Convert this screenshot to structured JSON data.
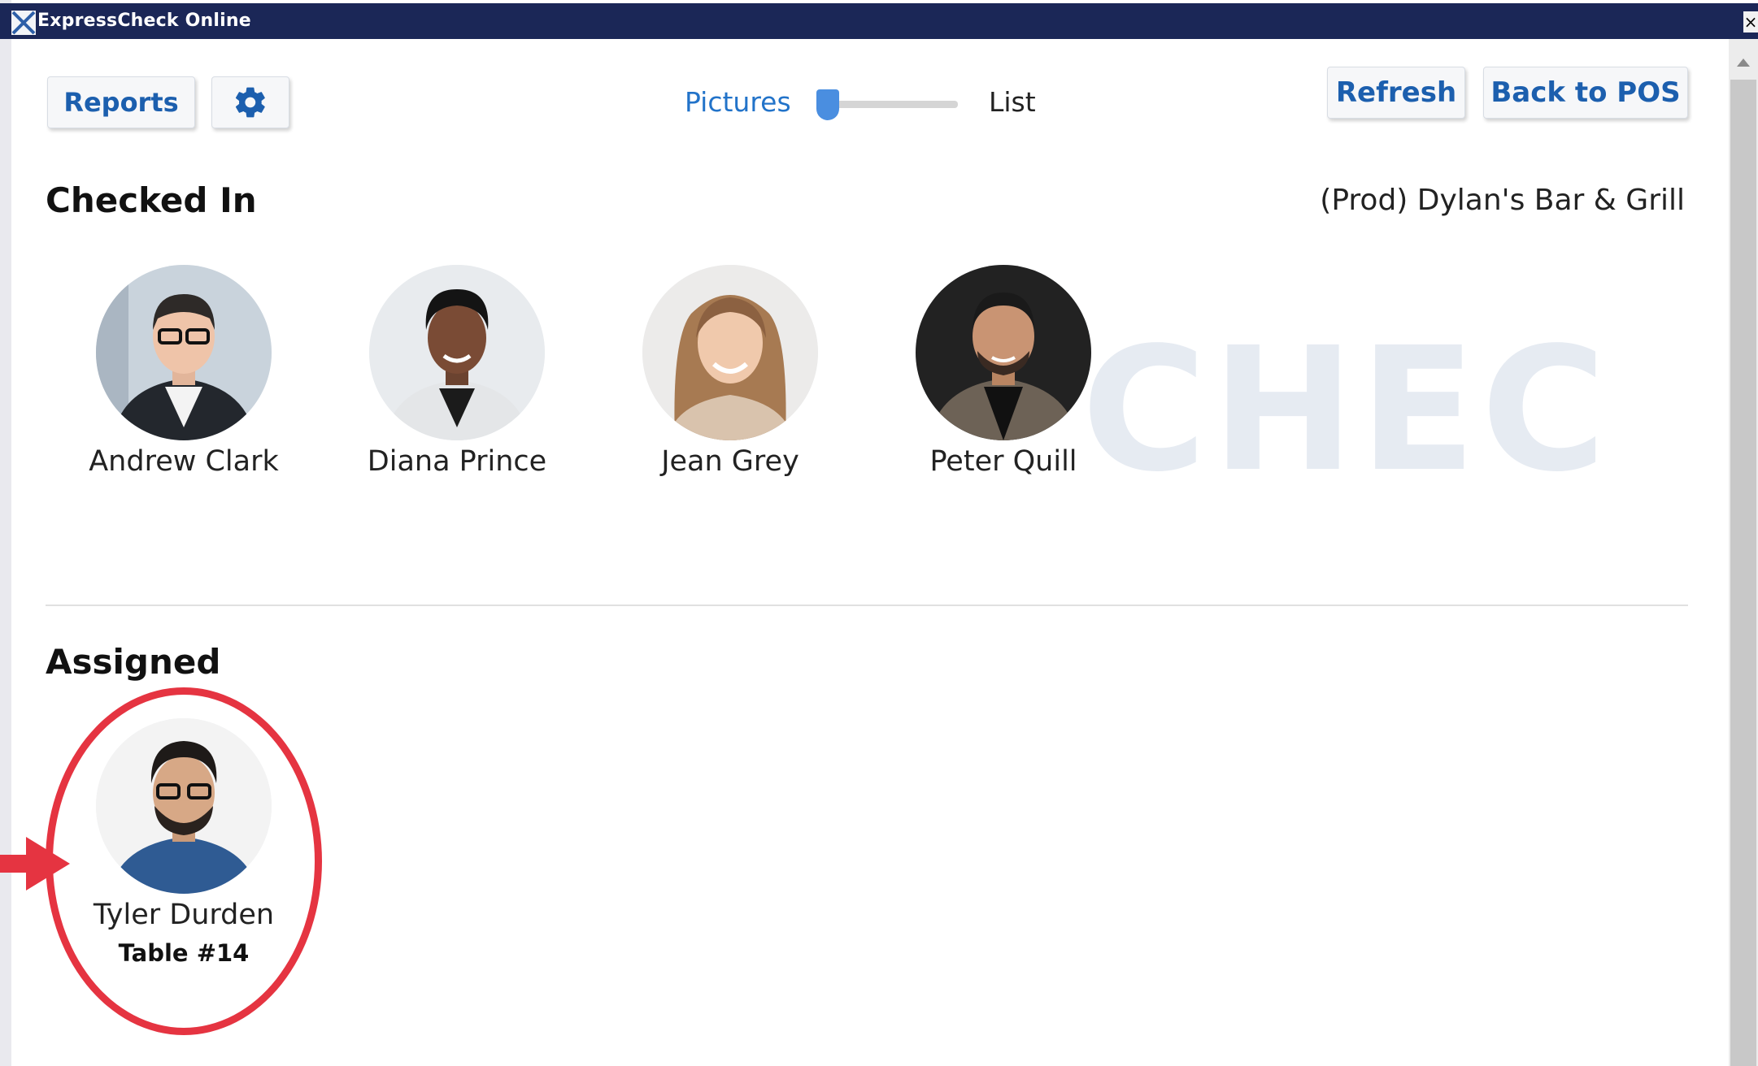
{
  "window": {
    "title": "ExpressCheck Online",
    "close_glyph": "×"
  },
  "toolbar": {
    "reports_label": "Reports",
    "settings_icon": "gear-icon",
    "refresh_label": "Refresh",
    "back_label": "Back to POS",
    "view_toggle": {
      "left_label": "Pictures",
      "right_label": "List",
      "selected": "Pictures"
    }
  },
  "venue": "(Prod) Dylan's Bar & Grill",
  "watermark": "CHECK",
  "checked_in": {
    "title": "Checked In",
    "people": [
      {
        "name": "Andrew Clark"
      },
      {
        "name": "Diana Prince"
      },
      {
        "name": "Jean Grey"
      },
      {
        "name": "Peter Quill"
      }
    ]
  },
  "assigned": {
    "title": "Assigned",
    "people": [
      {
        "name": "Tyler Durden",
        "table": "Table #14"
      }
    ]
  },
  "colors": {
    "titlebar": "#1b2757",
    "accent": "#1c5fae",
    "highlight": "#e53441"
  }
}
